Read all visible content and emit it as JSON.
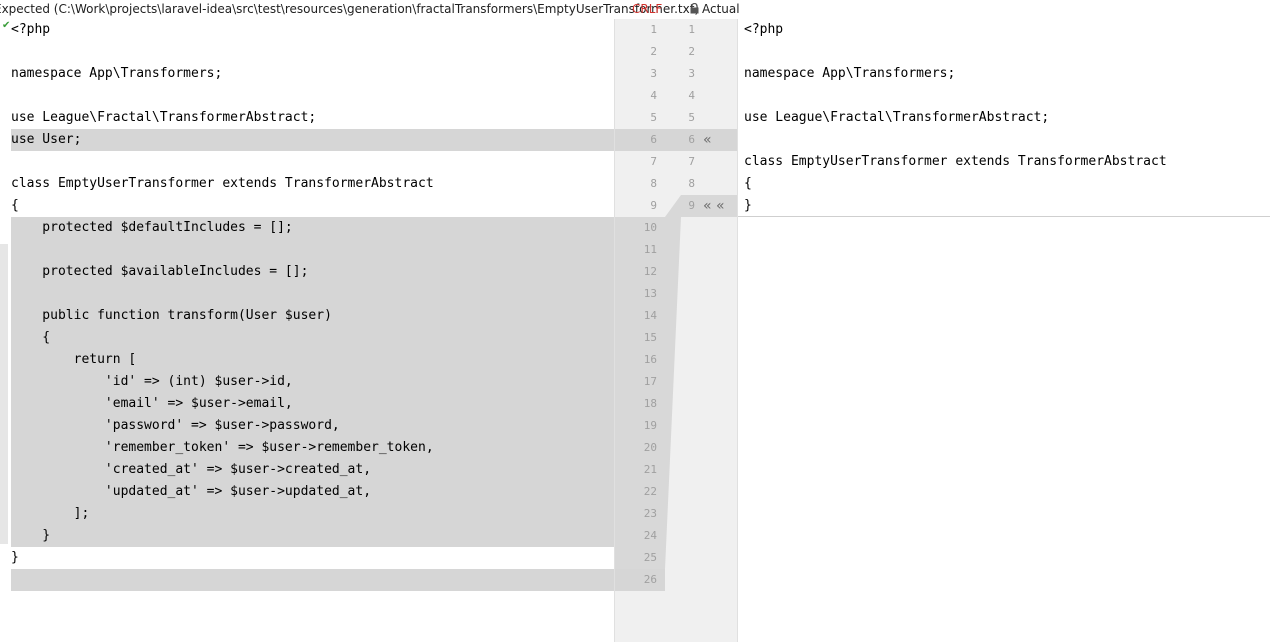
{
  "header": {
    "left_title": "Expected (C:\\Work\\projects\\laravel-idea\\src\\test\\resources\\generation\\fractalTransformers\\EmptyUserTransformer.txt)",
    "line_ending": "CRLF",
    "right_title": "Actual"
  },
  "left_lines": [
    "<?php",
    "",
    "namespace App\\Transformers;",
    "",
    "use League\\Fractal\\TransformerAbstract;",
    "use User;",
    "",
    "class EmptyUserTransformer extends TransformerAbstract",
    "{",
    "    protected $defaultIncludes = [];",
    "",
    "    protected $availableIncludes = [];",
    "",
    "    public function transform(User $user)",
    "    {",
    "        return [",
    "            'id' => (int) $user->id,",
    "            'email' => $user->email,",
    "            'password' => $user->password,",
    "            'remember_token' => $user->remember_token,",
    "            'created_at' => $user->created_at,",
    "            'updated_at' => $user->updated_at,",
    "        ];",
    "    }",
    "}",
    ""
  ],
  "right_lines": [
    "<?php",
    "",
    "namespace App\\Transformers;",
    "",
    "use League\\Fractal\\TransformerAbstract;",
    "",
    "class EmptyUserTransformer extends TransformerAbstract",
    "{",
    "}"
  ],
  "gutter_left_numbers": [
    "1",
    "2",
    "3",
    "4",
    "5",
    "6",
    "7",
    "8",
    "9",
    "10",
    "11",
    "12",
    "13",
    "14",
    "15",
    "16",
    "17",
    "18",
    "19",
    "20",
    "21",
    "22",
    "23",
    "24",
    "25",
    "26"
  ],
  "gutter_right_numbers": [
    "1",
    "2",
    "3",
    "4",
    "5",
    "6",
    "7",
    "8",
    "9"
  ],
  "arrows": {
    "single": "«",
    "double": "« «"
  },
  "colors": {
    "changed_bg": "#d6d6d6",
    "crlf": "#d1332e",
    "gutter_bg": "#f0f0f0"
  }
}
